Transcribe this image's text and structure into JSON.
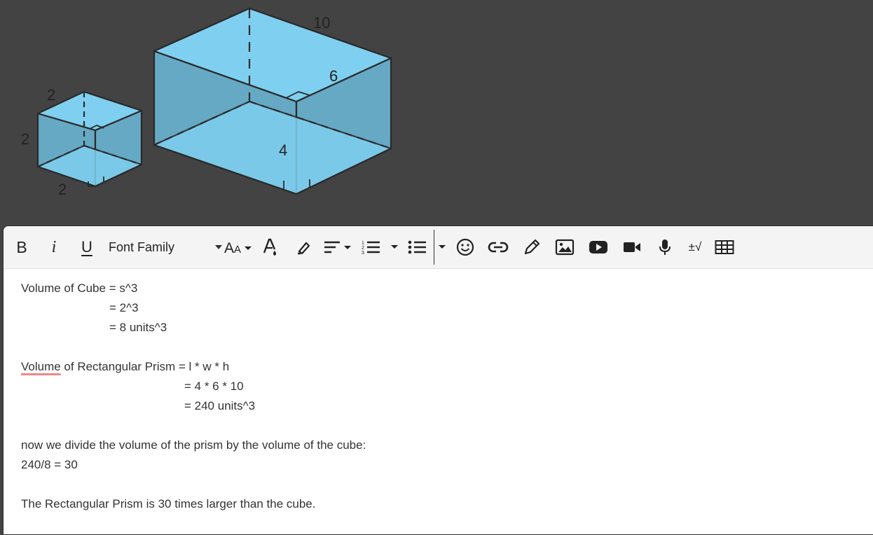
{
  "figure": {
    "cube_labels": {
      "top": "2",
      "side": "2",
      "bottom": "2"
    },
    "prism_labels": {
      "length": "10",
      "width": "6",
      "height": "4"
    },
    "fill_light": "#7fcff0",
    "fill_dark": "#66a9c4"
  },
  "toolbar": {
    "bold": "B",
    "italic": "i",
    "underline": "U",
    "font_family": "Font Family",
    "font_size_icon": "font-size-icon",
    "equation": "±√"
  },
  "content": {
    "cube_line1_word": "Volume",
    "cube_line1_rest": " of Cube = s^3",
    "cube_line2": "= 2^3",
    "cube_line3": "= 8 units^3",
    "prism_line1_word": "Volume",
    "prism_line1_rest": " of Rectangular Prism = l * w * h",
    "prism_line2": "= 4 * 6 * 10",
    "prism_line3": "= 240 units^3",
    "divide_line": "now we divide the volume of the prism by the volume of the cube:",
    "result_line": "240/8 = 30",
    "conclusion": "The Rectangular Prism is 30 times larger than the cube."
  },
  "colors": {
    "background": "#434343",
    "editor": "#ffffff",
    "toolbar": "#f4f4f4"
  }
}
